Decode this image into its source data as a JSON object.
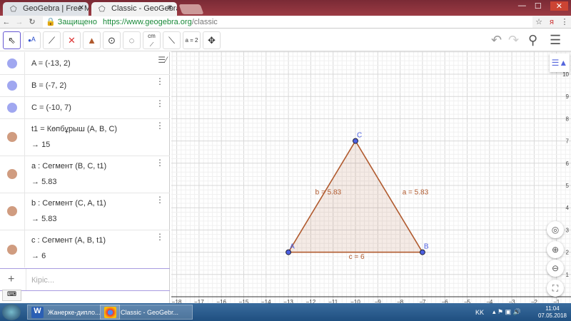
{
  "browser": {
    "tabs": [
      {
        "title": "GeoGebra | Free Math Ap",
        "active": false
      },
      {
        "title": "Classic - GeoGebra",
        "active": true
      }
    ],
    "security_label": "Защищено",
    "url_host": "https://www.geogebra.org",
    "url_path": "/classic"
  },
  "toolbar": {
    "tools": [
      "move",
      "point",
      "line",
      "perpendicular",
      "polygon",
      "circle",
      "conic",
      "distance",
      "reflect",
      "slider",
      "move-view"
    ],
    "slider_label": "a = 2",
    "distance_label": "cm"
  },
  "algebra": {
    "rows": [
      {
        "text": "A = (-13, 2)",
        "color": "#a0a7f0"
      },
      {
        "text": "B = (-7, 2)",
        "color": "#a0a7f0"
      },
      {
        "text": "C = (-10, 7)",
        "color": "#a0a7f0"
      },
      {
        "text": "t1 = Көпбұрыш (A, B, C)",
        "value": "15",
        "color": "#d09c80"
      },
      {
        "text": "a : Сегмент (B, C, t1)",
        "value": "5.83",
        "color": "#d09c80"
      },
      {
        "text": "b : Сегмент (C, A, t1)",
        "value": "5.83",
        "color": "#d09c80"
      },
      {
        "text": "c : Сегмент (A, B, t1)",
        "value": "6",
        "color": "#d09c80"
      }
    ],
    "input_placeholder": "Кіріс..."
  },
  "graphics": {
    "points": [
      {
        "name": "A",
        "x": -13,
        "y": 2
      },
      {
        "name": "B",
        "x": -7,
        "y": 2
      },
      {
        "name": "C",
        "x": -10,
        "y": 7
      }
    ],
    "segment_labels": [
      {
        "text": "a = 5.83",
        "x": -7.9,
        "y": 4.6
      },
      {
        "text": "b = 5.83",
        "x": -11.8,
        "y": 4.6
      },
      {
        "text": "c = 6",
        "x": -10.3,
        "y": 1.7
      }
    ],
    "xrange": [
      -18,
      -1
    ],
    "yrange": [
      1,
      10
    ],
    "colors": {
      "polygon": "#b05a2e",
      "point": "#4c5fe0",
      "grid": "#e4e4e4"
    }
  },
  "taskbar": {
    "items": [
      "Жанерке-дипло...",
      "Classic - GeoGebr..."
    ],
    "lang": "KK",
    "time": "11:04",
    "date": "07.05.2018"
  }
}
